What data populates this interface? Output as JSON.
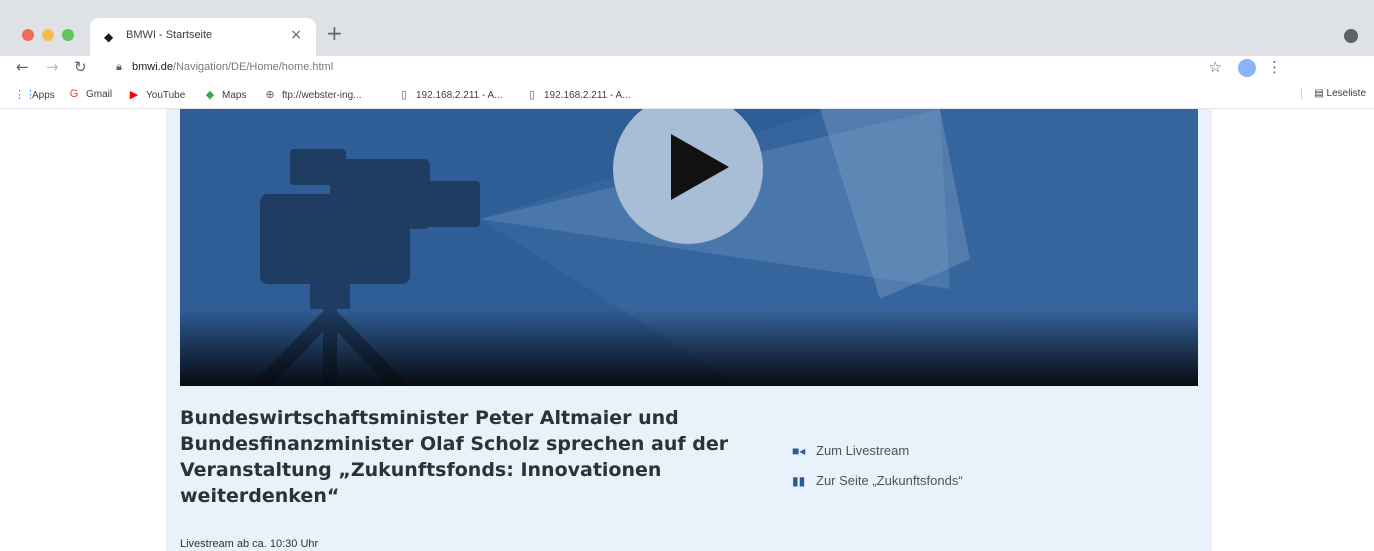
{
  "browser": {
    "tab": {
      "title": "BMWI - Startseite"
    },
    "url": {
      "domain": "bmwi.de",
      "path": "/Navigation/DE/Home/home.html"
    },
    "bookmarks": [
      {
        "label": "Apps",
        "icon": "apps-grid-icon"
      },
      {
        "label": "Gmail",
        "icon": "gmail-icon"
      },
      {
        "label": "YouTube",
        "icon": "youtube-icon"
      },
      {
        "label": "Maps",
        "icon": "maps-icon"
      },
      {
        "label": "ftp://webster-ing...",
        "icon": "globe-icon"
      },
      {
        "label": "192.168.2.211 - A...",
        "icon": "document-icon"
      },
      {
        "label": "192.168.2.211 - A...",
        "icon": "document-icon"
      }
    ],
    "reading_list": "Leseliste"
  },
  "colors": {
    "video_bg": "#2f5e97",
    "panel_bg": "#e9f2fa",
    "play_button": "#a8bdd6",
    "link_icon": "#2d5a96"
  },
  "teaser": {
    "headline_lines": [
      "Bundeswirtschaftsminister Peter Altmaier und",
      "Bundesfinanzminister Olaf Scholz sprechen auf der",
      "Veranstaltung „Zukunftsfonds: Innovationen",
      "weiterdenken“"
    ],
    "subline": "Livestream ab ca. 10:30 Uhr",
    "links": [
      {
        "label": "Zum Livestream",
        "icon": "video-camera-icon"
      },
      {
        "label": "Zur Seite „Zukunftsfonds“",
        "icon": "page-columns-icon"
      }
    ]
  }
}
